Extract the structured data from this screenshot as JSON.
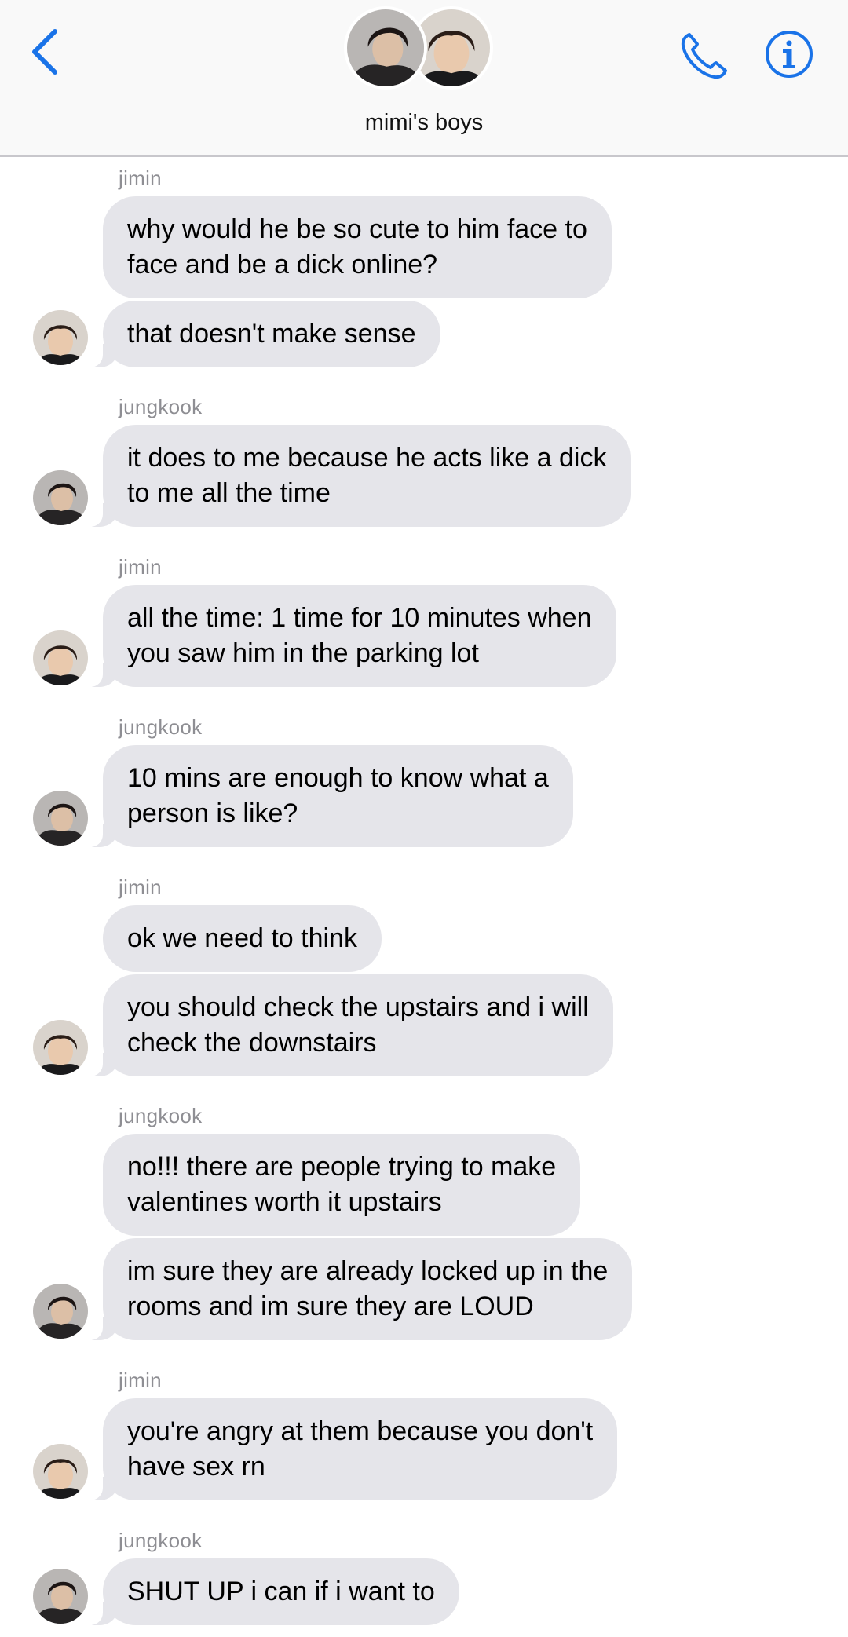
{
  "header": {
    "group_name": "mimi's boys",
    "accent_color": "#1a73e8",
    "back_icon": "chevron-left-icon",
    "call_icon": "phone-icon",
    "info_icon": "info-icon"
  },
  "messages": [
    {
      "sender": "jimin"
    },
    {
      "text": "why would he be so cute to him face to\nface and be a dick online?"
    },
    {
      "text": "that doesn't make sense"
    },
    {
      "sender": "jungkook"
    },
    {
      "text": "it does to me because he acts like a dick\nto me all the time"
    },
    {
      "sender": "jimin"
    },
    {
      "text": "all the time: 1 time for 10 minutes when\nyou saw him in the parking lot"
    },
    {
      "sender": "jungkook"
    },
    {
      "text": "10 mins are enough to know what a\nperson is like?"
    },
    {
      "sender": "jimin"
    },
    {
      "text": "ok we need to think"
    },
    {
      "text": "you should check the upstairs and i will\ncheck the downstairs"
    },
    {
      "sender": "jungkook"
    },
    {
      "text": "no!!! there are people trying to make\nvalentines worth it upstairs"
    },
    {
      "text": "im sure they are already locked up in the\nrooms and im sure they are LOUD"
    },
    {
      "sender": "jimin"
    },
    {
      "text": "you're angry at them because you don't\nhave sex rn"
    },
    {
      "sender": "jungkook"
    },
    {
      "text": "SHUT UP i can if i want to"
    }
  ]
}
